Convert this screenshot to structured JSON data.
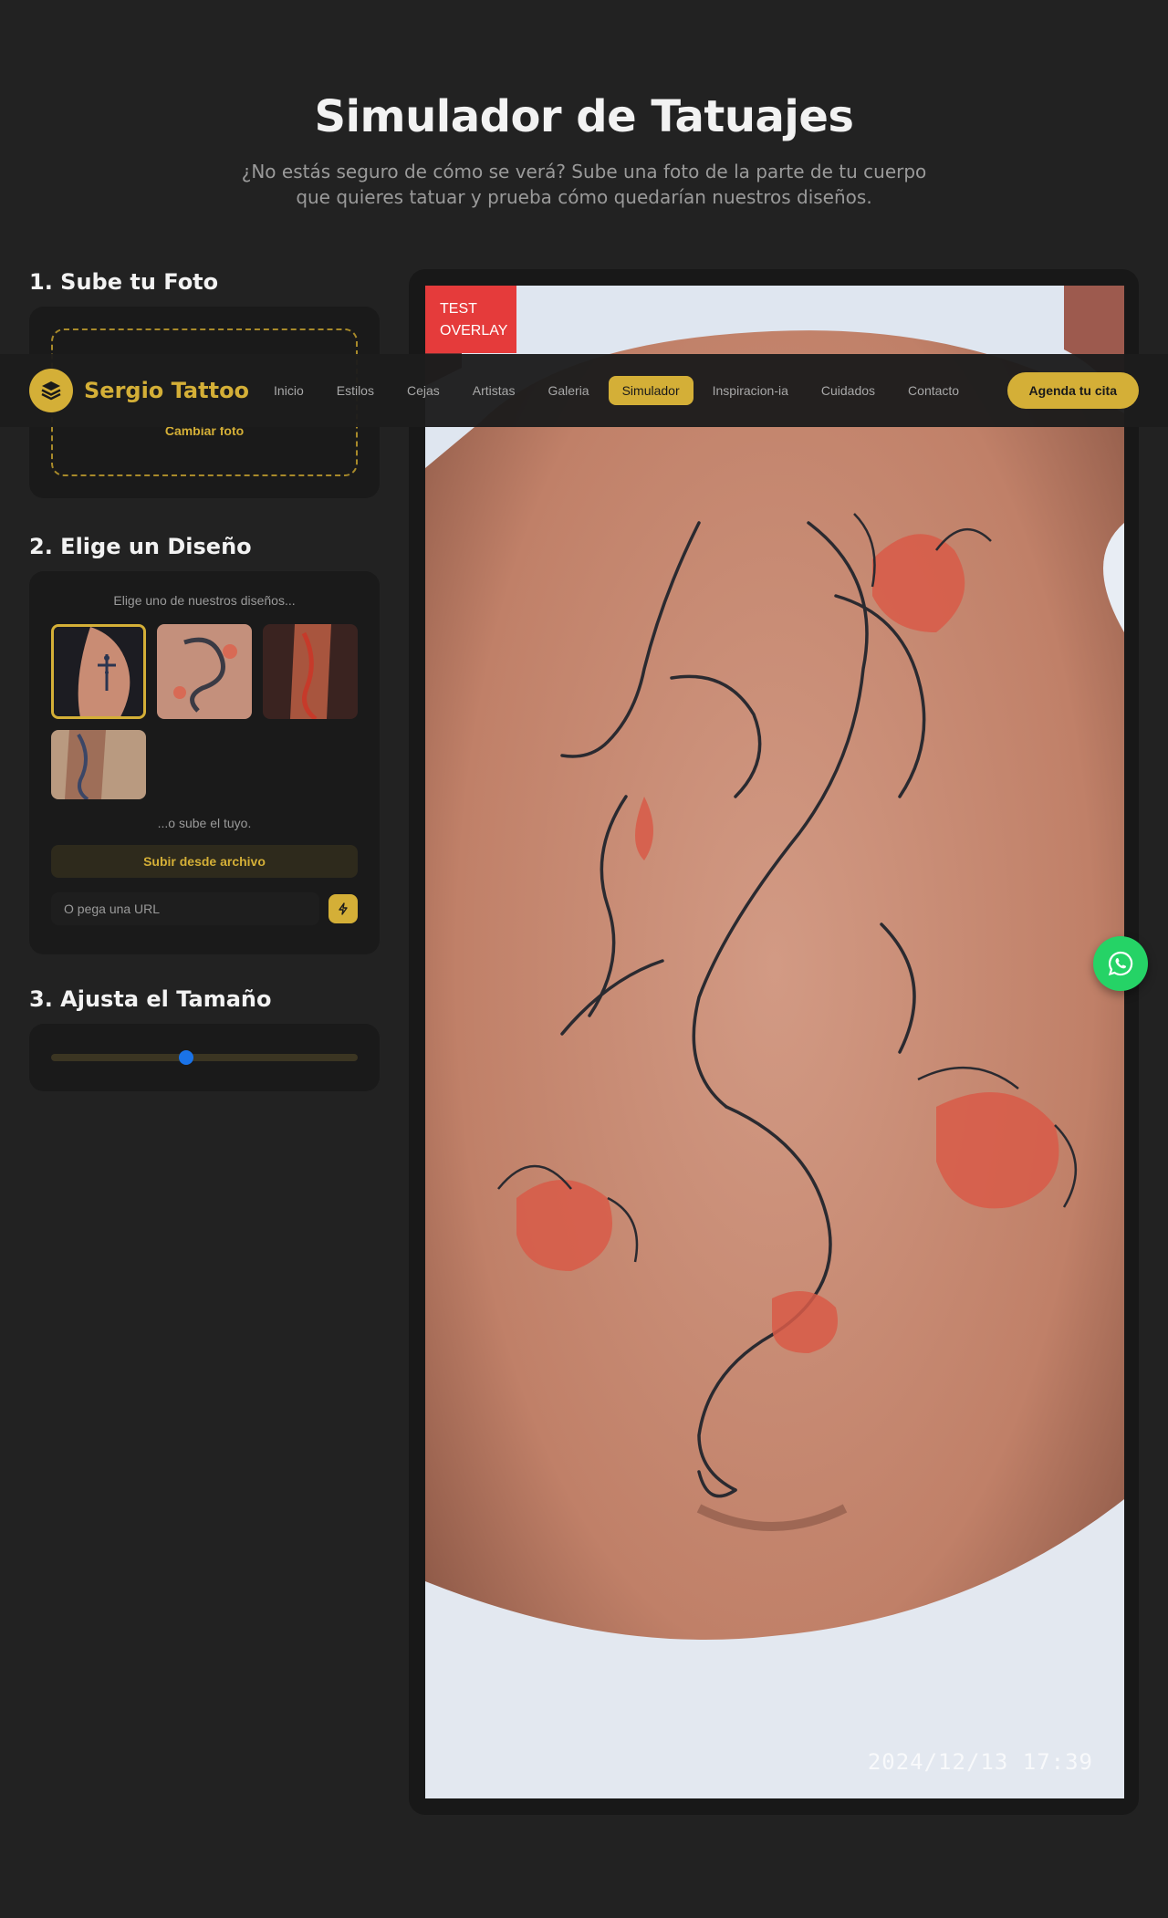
{
  "hero": {
    "title": "Simulador de Tatuajes",
    "subtitle": "¿No estás seguro de cómo se verá? Sube una foto de la parte de tu cuerpo que quieres tatuar y prueba cómo quedarían nuestros diseños."
  },
  "nav": {
    "brand": "Sergio Tattoo",
    "items": [
      "Inicio",
      "Estilos",
      "Cejas",
      "Artistas",
      "Galeria",
      "Simulador",
      "Inspiracion-ia",
      "Cuidados",
      "Contacto"
    ],
    "active": "Simulador",
    "cta": "Agenda tu cita"
  },
  "step1": {
    "title": "1. Sube tu Foto",
    "change_photo": "Cambiar foto"
  },
  "step2": {
    "title": "2. Elige un Diseño",
    "hint": "Elige uno de nuestros diseños...",
    "or_upload": "...o sube el tuyo.",
    "upload_button": "Subir desde archivo",
    "url_placeholder": "O pega una URL"
  },
  "step3": {
    "title": "3. Ajusta el Tamaño",
    "size_value": 0.44
  },
  "preview": {
    "overlay_label": "TEST OVERLAY",
    "timestamp": "2024/12/13 17:39"
  },
  "colors": {
    "accent": "#d4af37",
    "background": "#222222",
    "card": "#1a1a1a",
    "overlay_red": "#e53b3b",
    "whatsapp": "#25d366"
  },
  "icons": {
    "logo": "layers-icon",
    "url_submit": "bolt-icon",
    "floating": "whatsapp-icon"
  }
}
